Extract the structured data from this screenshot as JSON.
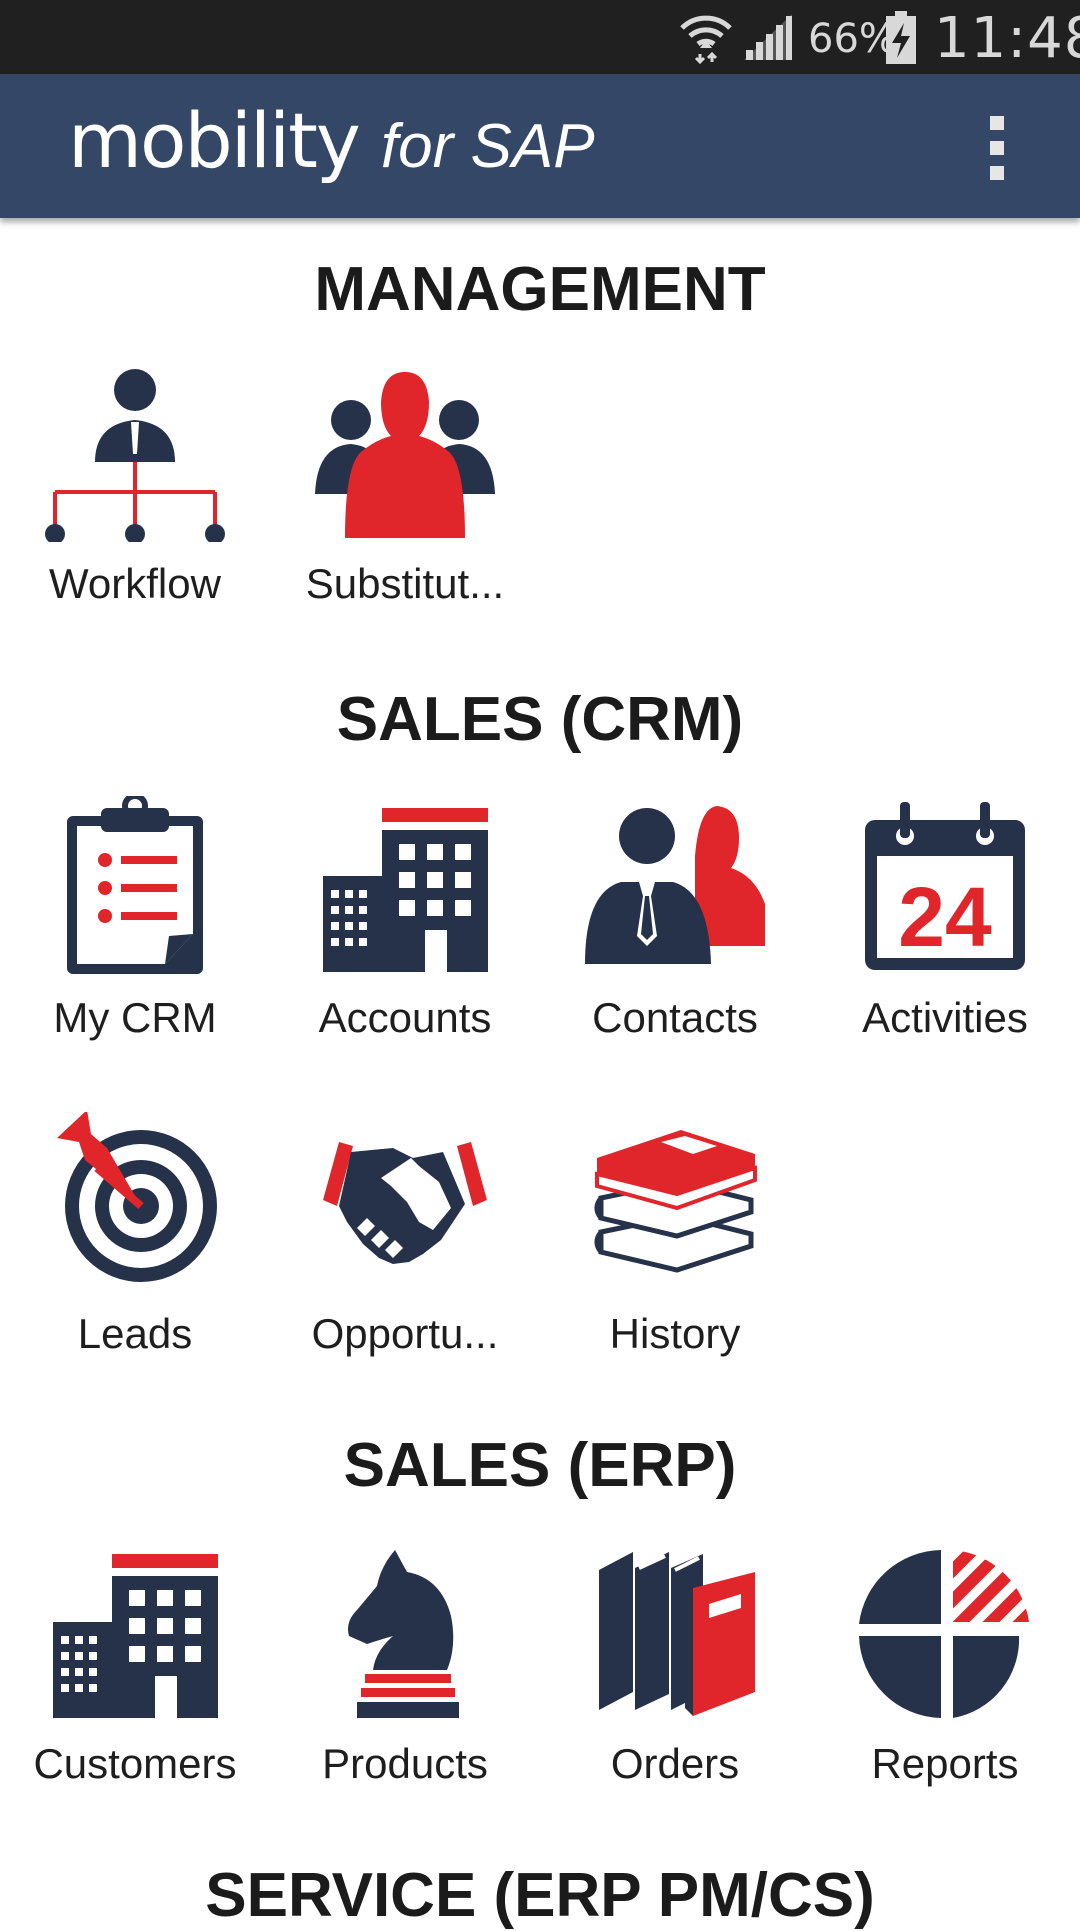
{
  "status_bar": {
    "battery_percent": "66%",
    "time": "11:48",
    "icons": [
      "wifi-icon",
      "signal-icon",
      "battery-charging-icon"
    ]
  },
  "app_bar": {
    "brand_main": "mobility",
    "brand_sub": "for SAP",
    "menu_icon": "overflow-menu-icon",
    "background_color": "#354766"
  },
  "colors": {
    "navy": "#26324a",
    "red": "#e0262b"
  },
  "sections": [
    {
      "title": "MANAGEMENT",
      "items": [
        {
          "label": "Workflow",
          "icon": "workflow-icon"
        },
        {
          "label": "Substitut...",
          "icon": "substitution-icon"
        }
      ]
    },
    {
      "title": "SALES (CRM)",
      "items": [
        {
          "label": "My CRM",
          "icon": "clipboard-icon"
        },
        {
          "label": "Accounts",
          "icon": "building-icon"
        },
        {
          "label": "Contacts",
          "icon": "contacts-icon"
        },
        {
          "label": "Activities",
          "icon": "calendar-icon",
          "icon_text": "24"
        },
        {
          "label": "Leads",
          "icon": "target-icon"
        },
        {
          "label": "Opportu...",
          "icon": "handshake-icon"
        },
        {
          "label": "History",
          "icon": "books-stack-icon"
        }
      ]
    },
    {
      "title": "SALES (ERP)",
      "items": [
        {
          "label": "Customers",
          "icon": "building-icon"
        },
        {
          "label": "Products",
          "icon": "chess-knight-icon"
        },
        {
          "label": "Orders",
          "icon": "binders-icon"
        },
        {
          "label": "Reports",
          "icon": "pie-chart-icon"
        }
      ]
    },
    {
      "title": "SERVICE (ERP PM/CS)"
    }
  ]
}
